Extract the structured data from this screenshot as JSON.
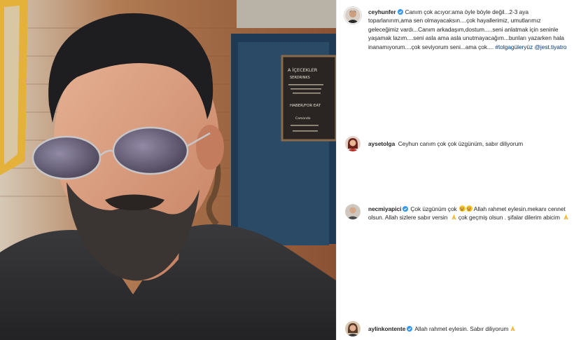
{
  "theme": {
    "text": "#262626",
    "link": "#00376b",
    "verified_blue": "#3897f0",
    "divider": "#e6e6e6"
  },
  "post": {
    "image_description": "selfie-photo",
    "sign": {
      "lines": [
        "A İÇECEKLER",
        "SERDRINKS",
        "HABER/FOR EAT",
        "Camondo"
      ]
    }
  },
  "comments": [
    {
      "username": "ceyhunfer",
      "verified": true,
      "text": "Canım çok acıyor:ama öyle böyle değil...2-3 aya toparlanırım,ama sen olmayacaksın....çok hayallerimiz, umutlarımız geleceğimiz vardı...Canım arkadaşım,dostum.....seni anlatmak için seninle yaşamak lazım....seni asla ama asla unutmayacağım...bunları yazarken hala inanamıyorum....çok seviyorum seni...ama çok.... ",
      "hashtag": "#tolgagüleryüz",
      "mention": "@jest.tiyatro"
    },
    {
      "username": "aysetolga",
      "verified": false,
      "text": "Ceyhun canım çok çok üzgünüm, sabır diliyorum"
    },
    {
      "username": "necmiyapici",
      "verified": true,
      "text_before": "Çok üzgünüm çok ",
      "text": "Allah rahmet eylesin.mekanı cennet olsun. Allah sizlere sabır versin ",
      "text_middle": " çok geçmiş olsun . şifalar dilerim abicim ",
      "emoji_faces": [
        "frowning-face",
        "frowning-face"
      ]
    },
    {
      "username": "aylinkontente",
      "verified": true,
      "text": "Allah rahmet eylesin. Sabır diliyorum"
    }
  ]
}
